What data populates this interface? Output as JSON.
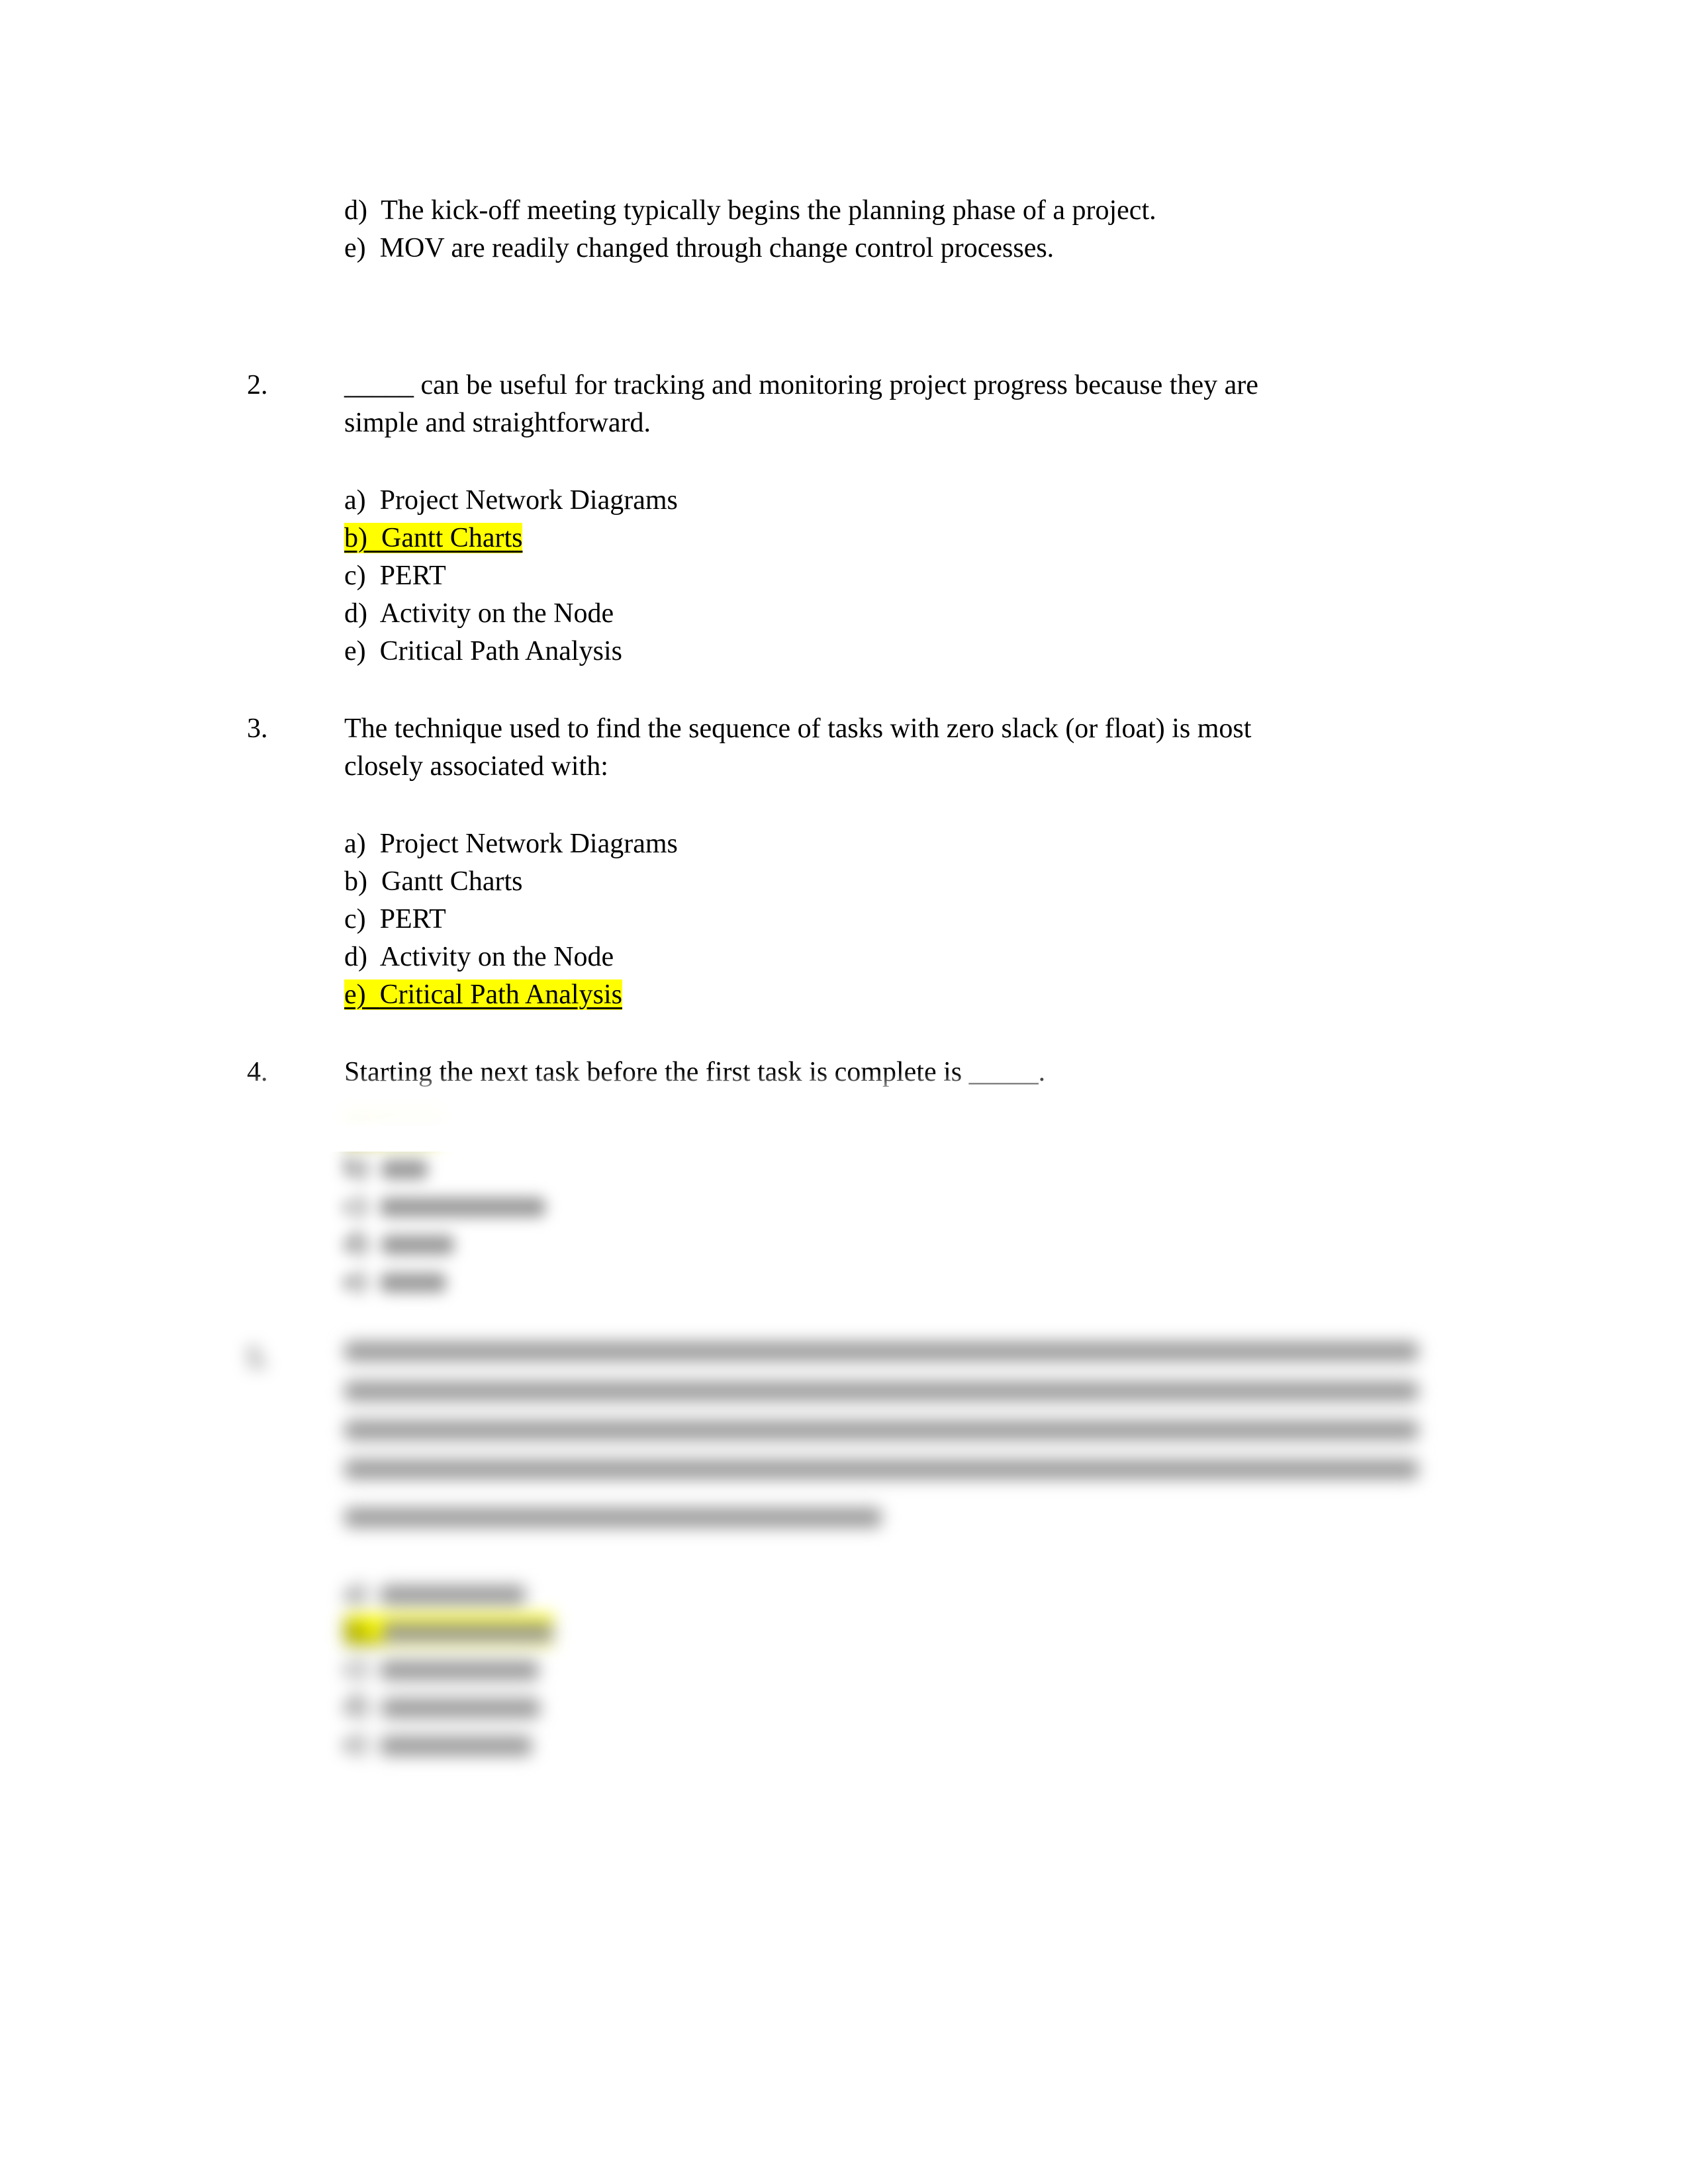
{
  "document": {
    "type": "multiple-choice-quiz",
    "page_background": "#ffffff",
    "highlight_color": "#ffff00",
    "text_color": "#000000"
  },
  "carryover_options": {
    "note": "Continuation of a question from the previous page",
    "items": [
      {
        "label": "d)",
        "text": "The kick-off meeting typically begins the planning phase of a project.",
        "highlighted": false
      },
      {
        "label": "e)",
        "text": "MOV are readily changed through change control processes.",
        "highlighted": false
      }
    ]
  },
  "questions": [
    {
      "number": "2.",
      "stem_before_blank": "",
      "blank": "_____",
      "stem_after_blank": " can be useful for tracking and monitoring project progress because they are simple and straightforward.",
      "stem_line1": "_____ can be useful for tracking and monitoring project progress because they are",
      "stem_line2": "simple and straightforward.",
      "blur": "none",
      "options": [
        {
          "label": "a)",
          "text": "Project Network Diagrams",
          "highlighted": false
        },
        {
          "label": "b)",
          "text": "Gantt Charts",
          "highlighted": true
        },
        {
          "label": "c)",
          "text": "PERT",
          "highlighted": false
        },
        {
          "label": "d)",
          "text": "Activity on the Node",
          "highlighted": false
        },
        {
          "label": "e)",
          "text": "Critical Path Analysis",
          "highlighted": false
        }
      ]
    },
    {
      "number": "3.",
      "stem_line1": "The technique used to find the sequence of tasks with zero slack (or float) is most",
      "stem_line2": "closely associated with:",
      "blur": "none",
      "options": [
        {
          "label": "a)",
          "text": "Project Network Diagrams",
          "highlighted": false
        },
        {
          "label": "b)",
          "text": "Gantt Charts",
          "highlighted": false
        },
        {
          "label": "c)",
          "text": "PERT",
          "highlighted": false
        },
        {
          "label": "d)",
          "text": "Activity on the Node",
          "highlighted": false
        },
        {
          "label": "e)",
          "text": "Critical Path Analysis",
          "highlighted": true
        }
      ]
    },
    {
      "number": "4.",
      "stem_line1": "Starting the next task before the first task is complete is _____.",
      "blur": "partial-heavy",
      "options": [
        {
          "label": "a)",
          "text": "",
          "highlighted": true,
          "blurred": true
        },
        {
          "label": "b)",
          "text": "",
          "highlighted": false,
          "blurred": true
        },
        {
          "label": "c)",
          "text": "",
          "highlighted": false,
          "blurred": true
        },
        {
          "label": "d)",
          "text": "",
          "highlighted": false,
          "blurred": true
        },
        {
          "label": "e)",
          "text": "",
          "highlighted": false,
          "blurred": true
        }
      ]
    },
    {
      "number": "5.",
      "stem_line1": "",
      "stem_line2": "",
      "stem_line3": "",
      "stem_line4": "",
      "stem_line5": "",
      "blur": "heavy",
      "options": [
        {
          "label": "a)",
          "text": "",
          "highlighted": false,
          "blurred": true
        },
        {
          "label": "b)",
          "text": "",
          "highlighted": true,
          "blurred": true
        },
        {
          "label": "c)",
          "text": "",
          "highlighted": false,
          "blurred": true
        },
        {
          "label": "d)",
          "text": "",
          "highlighted": false,
          "blurred": true
        },
        {
          "label": "e)",
          "text": "",
          "highlighted": false,
          "blurred": true
        }
      ]
    }
  ]
}
